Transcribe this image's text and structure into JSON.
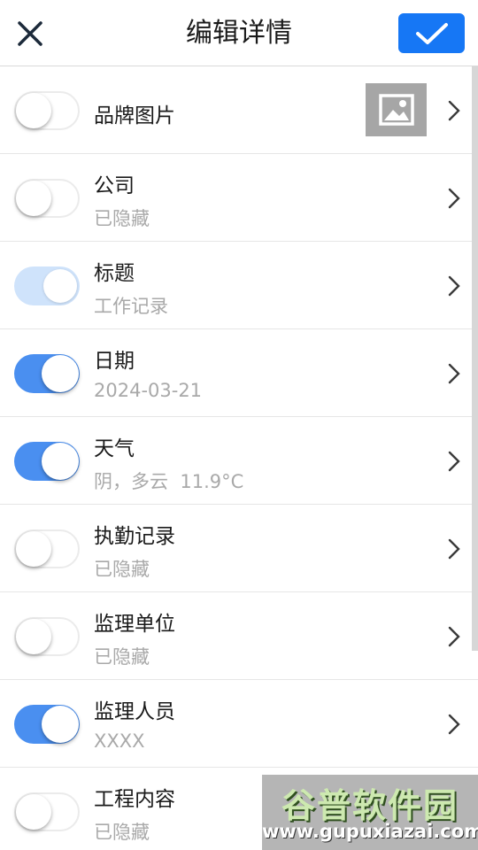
{
  "header": {
    "title": "编辑详情"
  },
  "colors": {
    "accent": "#1677f5",
    "toggle_on": "#4a8ff0",
    "toggle_dim": "#cfe3fb",
    "secondary_text": "#a9a9a9"
  },
  "rows": [
    {
      "label": "品牌图片",
      "value": "",
      "toggle": "off",
      "has_image": true
    },
    {
      "label": "公司",
      "value": "已隐藏",
      "toggle": "off"
    },
    {
      "label": "标题",
      "value": "工作记录",
      "toggle": "on-disabled"
    },
    {
      "label": "日期",
      "value": "2024-03-21",
      "toggle": "on"
    },
    {
      "label": "天气",
      "value": "阴，多云  11.9°C",
      "toggle": "on"
    },
    {
      "label": "执勤记录",
      "value": "已隐藏",
      "toggle": "off"
    },
    {
      "label": "监理单位",
      "value": "已隐藏",
      "toggle": "off"
    },
    {
      "label": "监理人员",
      "value": "XXXX",
      "toggle": "on"
    },
    {
      "label": "工程内容",
      "value": "已隐藏",
      "toggle": "off"
    }
  ],
  "watermark": {
    "title": "谷普软件园",
    "url": "www.gupuxiazai.com"
  }
}
